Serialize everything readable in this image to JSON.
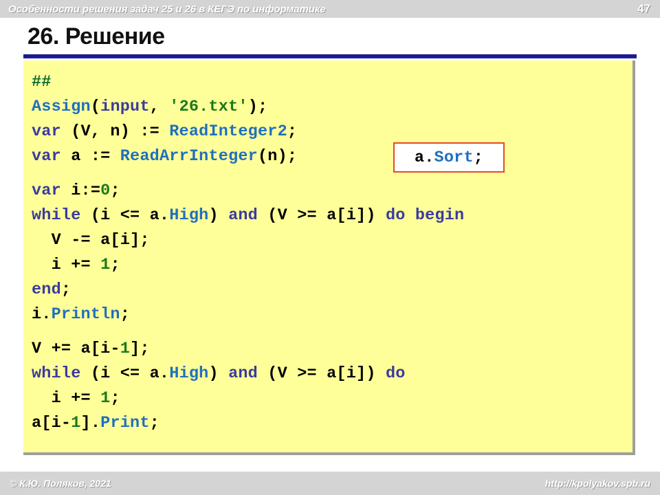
{
  "header": {
    "title": "Особенности решения задач 25 и 26 в КЕГЭ по информатике",
    "page_number": "47"
  },
  "slide": {
    "title": "26. Решение"
  },
  "code": {
    "lines": [
      {
        "id": "l1",
        "tokens": [
          {
            "t": "##",
            "c": "cmt"
          }
        ]
      },
      {
        "id": "l2",
        "tokens": [
          {
            "t": "Assign",
            "c": "fn"
          },
          {
            "t": "(",
            "c": ""
          },
          {
            "t": "input",
            "c": "kw"
          },
          {
            "t": ", ",
            "c": ""
          },
          {
            "t": "'26.txt'",
            "c": "str"
          },
          {
            "t": ");",
            "c": ""
          }
        ]
      },
      {
        "id": "l3",
        "tokens": [
          {
            "t": "var",
            "c": "kw"
          },
          {
            "t": " (V, n) := ",
            "c": ""
          },
          {
            "t": "ReadInteger2",
            "c": "fn"
          },
          {
            "t": ";",
            "c": ""
          }
        ]
      },
      {
        "id": "l4",
        "tokens": [
          {
            "t": "var",
            "c": "kw"
          },
          {
            "t": " a := ",
            "c": ""
          },
          {
            "t": "ReadArrInteger",
            "c": "fn"
          },
          {
            "t": "(n); ",
            "c": ""
          }
        ]
      },
      {
        "id": "l5",
        "tokens": [
          {
            "t": "var",
            "c": "kw"
          },
          {
            "t": " i:=",
            "c": ""
          },
          {
            "t": "0",
            "c": "num"
          },
          {
            "t": ";",
            "c": ""
          }
        ]
      },
      {
        "id": "l6",
        "tokens": [
          {
            "t": "while",
            "c": "kw"
          },
          {
            "t": " (i <= a.",
            "c": ""
          },
          {
            "t": "High",
            "c": "fn"
          },
          {
            "t": ") ",
            "c": ""
          },
          {
            "t": "and",
            "c": "kw"
          },
          {
            "t": " (V >= a[i]) ",
            "c": ""
          },
          {
            "t": "do begin",
            "c": "kw"
          }
        ]
      },
      {
        "id": "l7",
        "tokens": [
          {
            "t": "  V -= a[i];",
            "c": ""
          }
        ]
      },
      {
        "id": "l8",
        "tokens": [
          {
            "t": "  i += ",
            "c": ""
          },
          {
            "t": "1",
            "c": "num"
          },
          {
            "t": ";",
            "c": ""
          }
        ]
      },
      {
        "id": "l9",
        "tokens": [
          {
            "t": "end",
            "c": "kw"
          },
          {
            "t": ";",
            "c": ""
          }
        ]
      },
      {
        "id": "l10",
        "tokens": [
          {
            "t": "i.",
            "c": ""
          },
          {
            "t": "Println",
            "c": "fn"
          },
          {
            "t": ";",
            "c": ""
          }
        ]
      },
      {
        "id": "l11",
        "tokens": [
          {
            "t": "V += a[i-",
            "c": ""
          },
          {
            "t": "1",
            "c": "num"
          },
          {
            "t": "];",
            "c": ""
          }
        ]
      },
      {
        "id": "l12",
        "tokens": [
          {
            "t": "while",
            "c": "kw"
          },
          {
            "t": " (i <= a.",
            "c": ""
          },
          {
            "t": "High",
            "c": "fn"
          },
          {
            "t": ") ",
            "c": ""
          },
          {
            "t": "and",
            "c": "kw"
          },
          {
            "t": " (V >= a[i]) ",
            "c": ""
          },
          {
            "t": "do",
            "c": "kw"
          }
        ]
      },
      {
        "id": "l13",
        "tokens": [
          {
            "t": "  i += ",
            "c": ""
          },
          {
            "t": "1",
            "c": "num"
          },
          {
            "t": ";",
            "c": ""
          }
        ]
      },
      {
        "id": "l14",
        "tokens": [
          {
            "t": "a[i-",
            "c": ""
          },
          {
            "t": "1",
            "c": "num"
          },
          {
            "t": "].",
            "c": ""
          },
          {
            "t": "Print",
            "c": "fn"
          },
          {
            "t": ";",
            "c": ""
          }
        ]
      }
    ],
    "gaps_before": [
      "l5",
      "l11"
    ],
    "highlight_box": {
      "tokens": [
        {
          "t": "a.",
          "c": ""
        },
        {
          "t": "Sort",
          "c": "fn"
        },
        {
          "t": ";",
          "c": ""
        }
      ],
      "border_color": "#e8472c",
      "background": "#ffffff"
    },
    "panel_background": "#ffff99"
  },
  "footer": {
    "copyright": "© К.Ю. Поляков, 2021",
    "url": "http://kpolyakov.spb.ru"
  },
  "colors": {
    "header_bar": "#d4d4d4",
    "rule": "#1b1b8f",
    "keyword": "#3b3b9e",
    "function": "#1f6fbf",
    "number": "#1a7a1a",
    "string": "#1a7a1a",
    "comment": "#0a6b2e"
  }
}
